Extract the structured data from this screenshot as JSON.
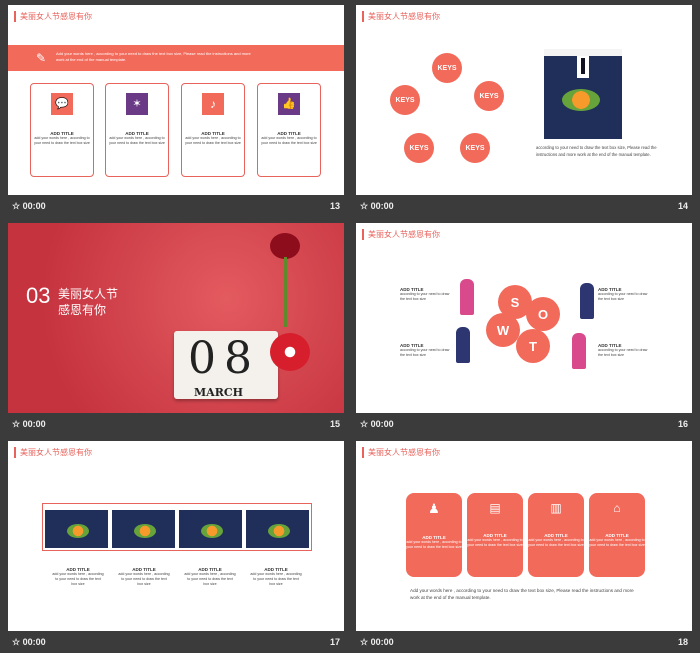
{
  "slide_title": "美丽女人节感恩有你",
  "time": "00:00",
  "slides": {
    "s13": {
      "num": "13",
      "banner": "Add your words here , according to your need to draw the text box size, Please read the instructions and more work at the end of the manual template.",
      "cards": [
        {
          "icon": "chat-icon",
          "title": "ADD TITLE",
          "text": "add your words here , according to your need to draw the text box size"
        },
        {
          "icon": "sparkle-icon",
          "title": "ADD TITLE",
          "text": "add your words here , according to your need to draw the text box size"
        },
        {
          "icon": "music-icon",
          "title": "ADD TITLE",
          "text": "add your words here , according to your need to draw the text box size"
        },
        {
          "icon": "thumbs-up-icon",
          "title": "ADD TITLE",
          "text": "add your words here , according to your need to draw the text box size"
        }
      ]
    },
    "s14": {
      "num": "14",
      "keys": [
        "KEYS",
        "KEYS",
        "KEYS",
        "KEYS",
        "KEYS"
      ],
      "text": "according to your need to draw the text box size, Please read the instructions and more work at the end of the manual template."
    },
    "s15": {
      "num": "15",
      "section": "03",
      "heading_line1": "美丽女人节",
      "heading_line2": "感恩有你",
      "cal_digits": "08",
      "cal_month": "MARCH"
    },
    "s16": {
      "num": "16",
      "letters": [
        "S",
        "W",
        "O",
        "T"
      ],
      "items": [
        {
          "title": "ADD TITLE",
          "text": "according to your need to draw the text box size"
        },
        {
          "title": "ADD TITLE",
          "text": "according to your need to draw the text box size"
        },
        {
          "title": "ADD TITLE",
          "text": "according to your need to draw the text box size"
        },
        {
          "title": "ADD TITLE",
          "text": "according to your need to draw the text box size"
        }
      ]
    },
    "s17": {
      "num": "17",
      "items": [
        {
          "title": "ADD TITLE",
          "text": "add your words here , according to your need to draw the text box size"
        },
        {
          "title": "ADD TITLE",
          "text": "add your words here , according to your need to draw the text box size"
        },
        {
          "title": "ADD TITLE",
          "text": "add your words here , according to your need to draw the text box size"
        },
        {
          "title": "ADD TITLE",
          "text": "add your words here , according to your need to draw the text box size"
        }
      ]
    },
    "s18": {
      "num": "18",
      "cards": [
        {
          "icon": "person-icon",
          "title": "ADD TITLE",
          "text": "add your words here , according to your need to draw the text box size"
        },
        {
          "icon": "document-icon",
          "title": "ADD TITLE",
          "text": "add your words here , according to your need to draw the text box size"
        },
        {
          "icon": "chart-icon",
          "title": "ADD TITLE",
          "text": "add your words here , according to your need to draw the text box size"
        },
        {
          "icon": "home-icon",
          "title": "ADD TITLE",
          "text": "add your words here , according to your need to draw the text box size"
        }
      ],
      "text": "Add your words here , according to your need to draw the text box size, Please read the instructions and more work at the end of the manual template."
    }
  }
}
